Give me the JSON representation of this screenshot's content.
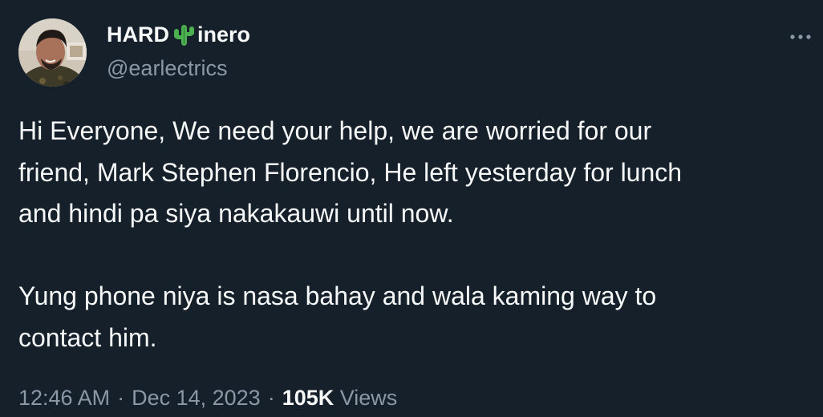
{
  "author": {
    "name_prefix": "HARD",
    "name_emoji": "cactus-emoji",
    "name_suffix": "inero",
    "handle": "@earlectrics"
  },
  "tweet": {
    "text": "Hi Everyone, We need your help, we are worried for our\nfriend, Mark Stephen Florencio, He left yesterday for lunch\nand hindi pa siya nakakauwi until now.\n\nYung phone niya is nasa bahay and wala kaming way to\ncontact him.",
    "time": "12:46 AM",
    "date": "Dec 14, 2023",
    "separator": "·",
    "views_count": "105K",
    "views_label": "Views"
  },
  "icons": {
    "more": "more-horizontal-icon"
  },
  "colors": {
    "background": "#15202b",
    "primary_text": "#f7f9f9",
    "secondary_text": "#8b98a5",
    "cactus": "#4caf50"
  }
}
